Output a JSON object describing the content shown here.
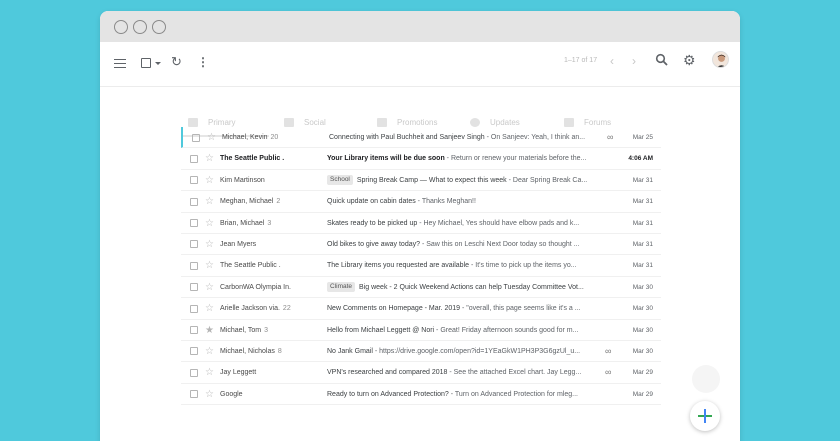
{
  "toolbar": {
    "page_count": "1–17 of 17",
    "prev_icon": "chevron-left-icon",
    "next_icon": "chevron-right-icon"
  },
  "tabs": [
    {
      "label": "Primary",
      "icon": "inbox-icon"
    },
    {
      "label": "Social",
      "icon": "people-icon"
    },
    {
      "label": "Promotions",
      "icon": "tag-icon"
    },
    {
      "label": "Updates",
      "icon": "info-icon"
    },
    {
      "label": "Forums",
      "icon": "forum-icon"
    }
  ],
  "emails": [
    {
      "sender": "Michael, Kevin",
      "count": "20",
      "label": "",
      "subject": "Connecting with Paul Buchheit and Sanjeev Singh",
      "snippet": " - On Sanjeev: Yeah, I think an...",
      "attachment": true,
      "date": "Mar 25",
      "unread": false,
      "starred": false
    },
    {
      "sender": "The Seattle Public .",
      "count": "",
      "label": "",
      "subject": "Your Library items will be due soon",
      "snippet": " - Return or renew your materials before the...",
      "attachment": false,
      "date": "4:06 AM",
      "unread": true,
      "starred": false
    },
    {
      "sender": "Kim Martinson",
      "count": "",
      "label": "School",
      "subject": "Spring Break Camp — What to expect this week",
      "snippet": " - Dear Spring Break Ca...",
      "attachment": false,
      "date": "Mar 31",
      "unread": false,
      "starred": false
    },
    {
      "sender": "Meghan, Michael",
      "count": "2",
      "label": "",
      "subject": "Quick update on cabin dates",
      "snippet": " - Thanks Meghan!!",
      "attachment": false,
      "date": "Mar 31",
      "unread": false,
      "starred": false
    },
    {
      "sender": "Brian, Michael",
      "count": "3",
      "label": "",
      "subject": "Skates ready to be picked up",
      "snippet": " - Hey Michael, Yes should have elbow pads and k...",
      "attachment": false,
      "date": "Mar 31",
      "unread": false,
      "starred": false
    },
    {
      "sender": "Jean Myers",
      "count": "",
      "label": "",
      "subject": "Old bikes to give away today?",
      "snippet": " - Saw this on Leschi Next Door today so thought ...",
      "attachment": false,
      "date": "Mar 31",
      "unread": false,
      "starred": false
    },
    {
      "sender": "The Seattle Public .",
      "count": "",
      "label": "",
      "subject": "The Library items you requested are available",
      "snippet": " - It's time to pick up the items yo...",
      "attachment": false,
      "date": "Mar 31",
      "unread": false,
      "starred": false
    },
    {
      "sender": "CarbonWA Olympia In.",
      "count": "",
      "label": "Climate",
      "subject": "Big week - 2 Quick Weekend Actions can help Tuesday Committee Vot...",
      "snippet": "",
      "attachment": false,
      "date": "Mar 30",
      "unread": false,
      "starred": false
    },
    {
      "sender": "Arielle Jackson via.",
      "count": "22",
      "label": "",
      "subject": "New Comments on Homepage - Mar. 2019",
      "snippet": " - \"overall, this page seems like it's a ...",
      "attachment": false,
      "date": "Mar 30",
      "unread": false,
      "starred": false
    },
    {
      "sender": "Michael, Tom",
      "count": "3",
      "label": "",
      "subject": "Hello from Michael Leggett @ Nori",
      "snippet": " - Great! Friday afternoon sounds good for m...",
      "attachment": false,
      "date": "Mar 30",
      "unread": false,
      "starred": true
    },
    {
      "sender": "Michael, Nicholas",
      "count": "8",
      "label": "",
      "subject": "No Jank Gmail",
      "snippet": " - https://drive.google.com/open?id=1YEaGkW1PH3P3G6gzUl_u...",
      "attachment": true,
      "date": "Mar 30",
      "unread": false,
      "starred": false
    },
    {
      "sender": "Jay Leggett",
      "count": "",
      "label": "",
      "subject": "VPN's researched and compared 2018",
      "snippet": " - See the attached Excel chart. Jay Legg...",
      "attachment": true,
      "date": "Mar 29",
      "unread": false,
      "starred": false
    },
    {
      "sender": "Google",
      "count": "",
      "label": "",
      "subject": "Ready to turn on Advanced Protection?",
      "snippet": " - Turn on Advanced Protection for mleg...",
      "attachment": false,
      "date": "Mar 29",
      "unread": false,
      "starred": false
    }
  ]
}
